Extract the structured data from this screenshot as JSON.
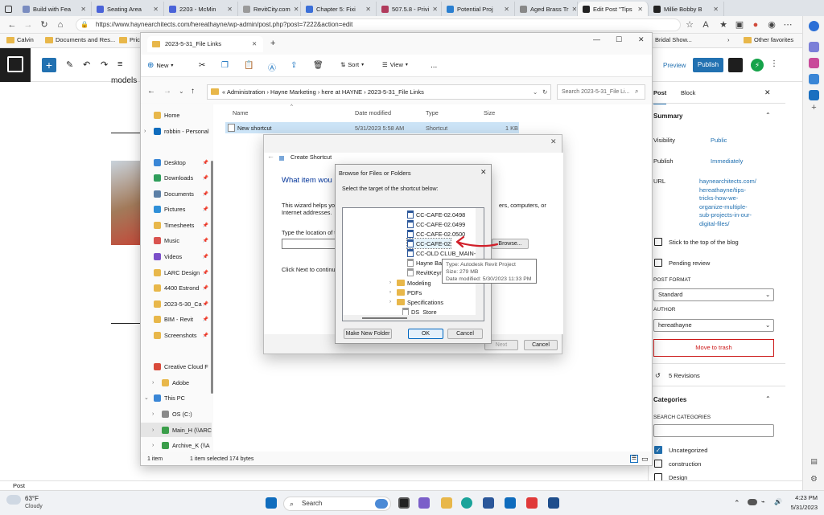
{
  "browser": {
    "tabs": [
      {
        "label": "Build with Fea",
        "color": "#7a8cc0"
      },
      {
        "label": "Seating Area",
        "color": "#4a63d8"
      },
      {
        "label": "2203 - McMin",
        "color": "#4a63d8"
      },
      {
        "label": "RevitCity.com",
        "color": "#9a9a9a"
      },
      {
        "label": "Chapter 5: Fixi",
        "color": "#3b6fd8"
      },
      {
        "label": "507.5.8 - Privi",
        "color": "#b03a5c"
      },
      {
        "label": "Potential Proj",
        "color": "#2a7fd0"
      },
      {
        "label": "Aged Brass Tr",
        "color": "#888888"
      },
      {
        "label": "Edit Post \"Tips",
        "color": "#222222"
      },
      {
        "label": "Millie Bobby B",
        "color": "#222222"
      }
    ],
    "url": "https://www.haynearchitects.com/hereathayne/wp-admin/post.php?post=7222&action=edit",
    "favorites": [
      "Calvin",
      "Documents and Res...",
      "Pric"
    ],
    "favorites_right": [
      "Bridal Show...",
      "Other favorites"
    ]
  },
  "wp": {
    "body_fragment": "models",
    "preview_label": "Preview",
    "publish_label": "Publish",
    "sidebar_tabs": [
      "Post",
      "Block"
    ],
    "summary_title": "Summary",
    "visibility_label": "Visibility",
    "visibility_value": "Public",
    "publish_label2": "Publish",
    "publish_value": "Immediately",
    "url_label": "URL",
    "url_value_lines": [
      "haynearchitects.com/",
      "hereathayne/tips-",
      "tricks-how-we-",
      "organize-multiple-",
      "sub-projects-in-our-",
      "digital-files/"
    ],
    "stick_top": "Stick to the top of the blog",
    "pending_review": "Pending review",
    "post_format_label": "POST FORMAT",
    "post_format_value": "Standard",
    "author_label": "AUTHOR",
    "author_value": "hereathayne",
    "move_trash": "Move to trash",
    "revisions": "5 Revisions",
    "categories_title": "Categories",
    "search_categories": "SEARCH CATEGORIES",
    "categories": [
      "Uncategorized",
      "construction",
      "Design"
    ],
    "status_text": "Post"
  },
  "explorer": {
    "tab_title": "2023-5-31_File Links",
    "toolbar": {
      "new_label": "New",
      "sort_label": "Sort",
      "view_label": "View",
      "more_label": "..."
    },
    "breadcrumb": [
      "Administration",
      "Hayne Marketing",
      "here at HAYNE",
      "2023-5-31_File Links"
    ],
    "search_placeholder": "Search 2023-5-31_File Li...",
    "nav_items": [
      {
        "label": "Home",
        "color": "#e8b74a",
        "pin": false
      },
      {
        "label": "robbin - Personal",
        "color": "#0f6cbd",
        "pin": false
      },
      {
        "label": "Desktop",
        "color": "#3a86d6",
        "pin": true
      },
      {
        "label": "Downloads",
        "color": "#2f9e5b",
        "pin": true
      },
      {
        "label": "Documents",
        "color": "#5b7fa6",
        "pin": true
      },
      {
        "label": "Pictures",
        "color": "#2f8fd8",
        "pin": true
      },
      {
        "label": "Timesheets",
        "color": "#e8b74a",
        "pin": true
      },
      {
        "label": "Music",
        "color": "#d9534f",
        "pin": true
      },
      {
        "label": "Videos",
        "color": "#7b4fc9",
        "pin": true
      },
      {
        "label": "LARC Design",
        "color": "#e8b74a",
        "pin": true
      },
      {
        "label": "4400 Estrond",
        "color": "#e8b74a",
        "pin": true
      },
      {
        "label": "2023-5-30_Ca",
        "color": "#e8b74a",
        "pin": true
      },
      {
        "label": "BIM - Revit",
        "color": "#e8b74a",
        "pin": true
      },
      {
        "label": "Screenshots",
        "color": "#e8b74a",
        "pin": true
      },
      {
        "label": "Creative Cloud F",
        "color": "#d94a3a",
        "pin": false
      },
      {
        "label": "Adobe",
        "color": "#e8b74a",
        "pin": false
      },
      {
        "label": "This PC",
        "color": "#3a86d6",
        "pin": false
      },
      {
        "label": "OS (C:)",
        "color": "#8a8a8a",
        "pin": false
      },
      {
        "label": "Main_H (\\\\ARC",
        "color": "#3a9e4a",
        "pin": false
      },
      {
        "label": "Archive_K (\\\\A",
        "color": "#3a9e4a",
        "pin": false
      }
    ],
    "columns": [
      "Name",
      "Date modified",
      "Type",
      "Size"
    ],
    "file": {
      "name": "New shortcut",
      "date": "5/31/2023 5:58 AM",
      "type": "Shortcut",
      "size": "1 KB"
    },
    "status": {
      "count": "1 item",
      "selected": "1 item selected  174 bytes"
    }
  },
  "wizard": {
    "title": "Create Shortcut",
    "heading": "What item wou",
    "desc1": "This wizard helps yo",
    "desc1b": "ers, computers, or",
    "desc2": "Internet addresses.",
    "location_label": "Type the location of t",
    "browse_label": "Browse...",
    "click_next": "Click Next to continu",
    "next_label": "Next",
    "cancel_label": "Cancel"
  },
  "browse": {
    "title": "Browse for Files or Folders",
    "instruction": "Select the target of the shortcut below:",
    "files": [
      "CC-CAFE-02.0498",
      "CC-CAFE-02.0499",
      "CC-CAFE-02.0500",
      "CC-CAFE-02",
      "CC-OLD CLUB_MAIN-",
      "Hayne Ba",
      "RevitKeyn"
    ],
    "folders": [
      "Modeling",
      "PDFs",
      "Specifications"
    ],
    "last_item": "DS_Store",
    "tooltip": [
      "Type: Autodesk Revit Project",
      "Size: 279 MB",
      "Date modified: 5/30/2023 11:33 PM"
    ],
    "make_folder": "Make New Folder",
    "ok": "OK",
    "cancel": "Cancel"
  },
  "taskbar": {
    "weather_temp": "63°F",
    "weather_desc": "Cloudy",
    "search": "Search",
    "time": "4:23 PM",
    "date": "5/31/2023"
  }
}
